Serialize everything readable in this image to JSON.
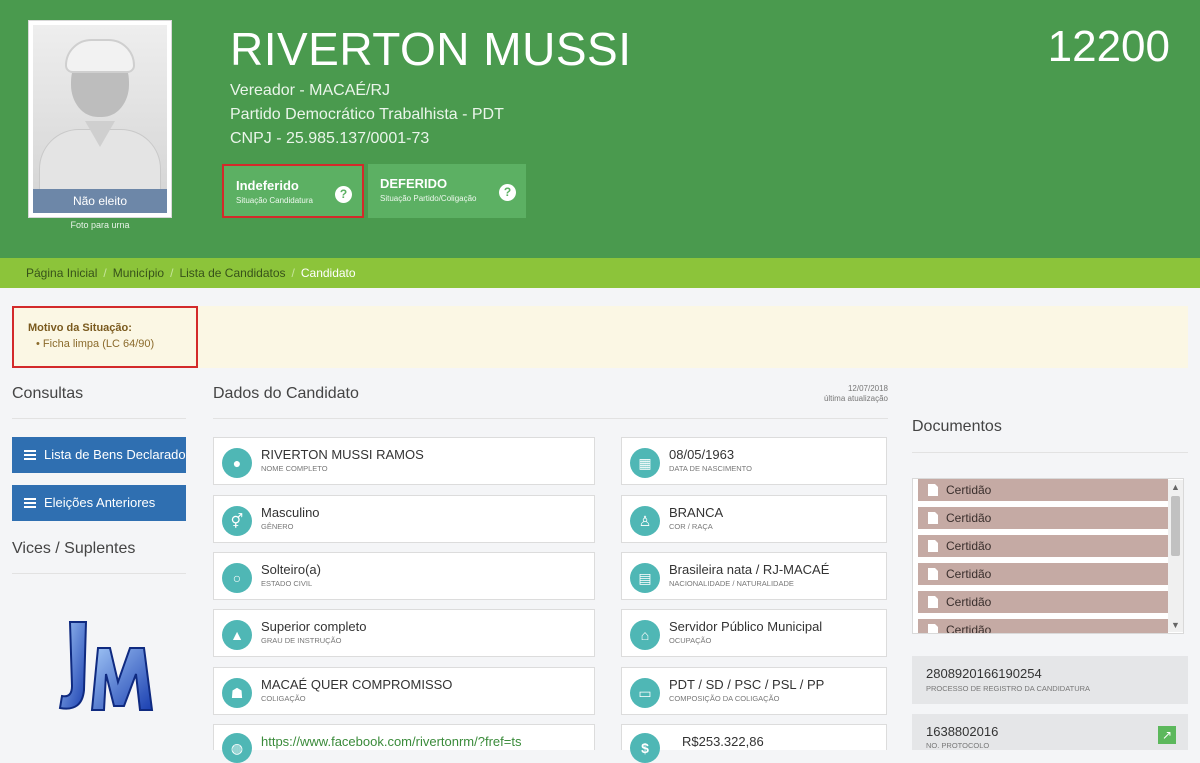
{
  "header": {
    "name": "RIVERTON MUSSI",
    "number": "12200",
    "role": "Vereador - MACAÉ/RJ",
    "party": "Partido Democrático Trabalhista - PDT",
    "cnpj": "CNPJ - 25.985.137/0001-73",
    "photo_status": "Não eleito",
    "photo_caption": "Foto para urna",
    "status_candidatura": {
      "label": "Indeferido",
      "sub": "Situação Candidatura"
    },
    "status_partido": {
      "label": "DEFERIDO",
      "sub": "Situação Partido/Coligação"
    },
    "help_glyph": "?"
  },
  "breadcrumb": [
    "Página Inicial",
    "Município",
    "Lista de Candidatos",
    "Candidato"
  ],
  "breadcrumb_sep": "/",
  "reason": {
    "title": "Motivo da Situação:",
    "item": "• Ficha limpa (LC 64/90)"
  },
  "sidebar": {
    "consultas_title": "Consultas",
    "buttons": [
      "Lista de Bens Declarados",
      "Eleições Anteriores"
    ],
    "vices_title": "Vices / Suplentes"
  },
  "main": {
    "title": "Dados do Candidato",
    "update_date": "12/07/2018",
    "update_label": "última atualização",
    "fields": [
      {
        "value": "RIVERTON MUSSI RAMOS",
        "label": "NOME COMPLETO",
        "icon": "user-icon"
      },
      {
        "value": "08/05/1963",
        "label": "DATA DE NASCIMENTO",
        "icon": "calendar-icon"
      },
      {
        "value": "Masculino",
        "label": "GÊNERO",
        "icon": "gender-icon"
      },
      {
        "value": "BRANCA",
        "label": "COR / RAÇA",
        "icon": "person-icon"
      },
      {
        "value": "Solteiro(a)",
        "label": "ESTADO CIVIL",
        "icon": "ring-icon"
      },
      {
        "value": "Brasileira nata / RJ-MACAÉ",
        "label": "NACIONALIDADE / NATURALIDADE",
        "icon": "map-icon"
      },
      {
        "value": "Superior completo",
        "label": "GRAU DE INSTRUÇÃO",
        "icon": "graduation-icon"
      },
      {
        "value": "Servidor Público Municipal",
        "label": "OCUPAÇÃO",
        "icon": "bank-icon"
      },
      {
        "value": "MACAÉ QUER COMPROMISSO",
        "label": "COLIGAÇÃO",
        "icon": "group-icon"
      },
      {
        "value": "PDT / SD / PSC / PSL / PP",
        "label": "COMPOSIÇÃO DA COLIGAÇÃO",
        "icon": "folder-icon"
      },
      {
        "value": "https://www.facebook.com/rivertonrm/?fref=ts",
        "label": "",
        "icon": "globe-icon"
      },
      {
        "value": "R$253.322,86",
        "label": "",
        "icon": "money-icon"
      }
    ]
  },
  "documents": {
    "title": "Documentos",
    "items": [
      "Certidão",
      "Certidão",
      "Certidão",
      "Certidão",
      "Certidão",
      "Certidão"
    ],
    "processo": {
      "value": "2808920166190254",
      "label": "PROCESSO DE REGISTRO DA CANDIDATURA"
    },
    "protocolo": {
      "value": "1638802016",
      "label": "NO. PROTOCOLO"
    }
  },
  "colors": {
    "header_green": "#4a9a4e",
    "breadcrumb_green": "#8cc43a",
    "button_blue": "#2f6fb1",
    "teal_icon": "#4fb7b5",
    "highlight_red": "#d32a2a"
  }
}
